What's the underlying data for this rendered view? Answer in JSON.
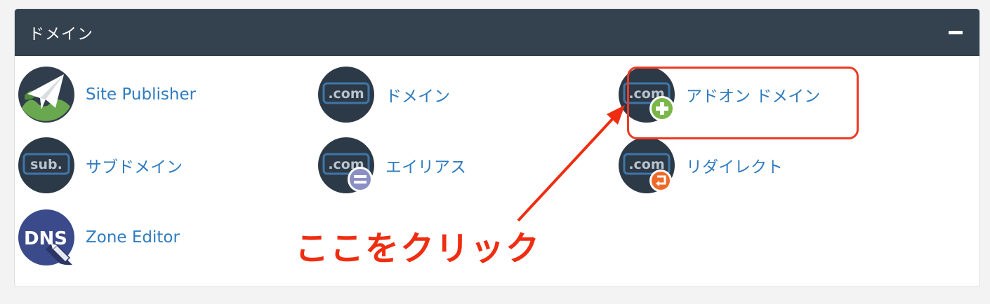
{
  "panel": {
    "title": "ドメイン",
    "collapse_icon": "minus-icon"
  },
  "items": [
    {
      "label": "Site Publisher",
      "icon": "paper-plane-globe-icon"
    },
    {
      "label": "ドメイン",
      "icon": "dot-com-icon"
    },
    {
      "label": "アドオン ドメイン",
      "icon": "dot-com-plus-icon"
    },
    {
      "label": "サブドメイン",
      "icon": "sub-domain-icon"
    },
    {
      "label": "エイリアス",
      "icon": "dot-com-equals-icon"
    },
    {
      "label": "リダイレクト",
      "icon": "dot-com-redirect-icon"
    },
    {
      "label": "Zone Editor",
      "icon": "dns-pencil-icon"
    }
  ],
  "icon_text": {
    "com": ".com",
    "sub": "sub.",
    "dns": "DNS"
  },
  "annotation": {
    "text": "ここをクリック"
  },
  "colors": {
    "header_bg": "#34424f",
    "link": "#2f7bbf",
    "annotation": "#ef2d10",
    "plus_badge": "#7ab648",
    "equals_badge": "#8a8fc4",
    "redirect_badge": "#ef6a2a"
  }
}
